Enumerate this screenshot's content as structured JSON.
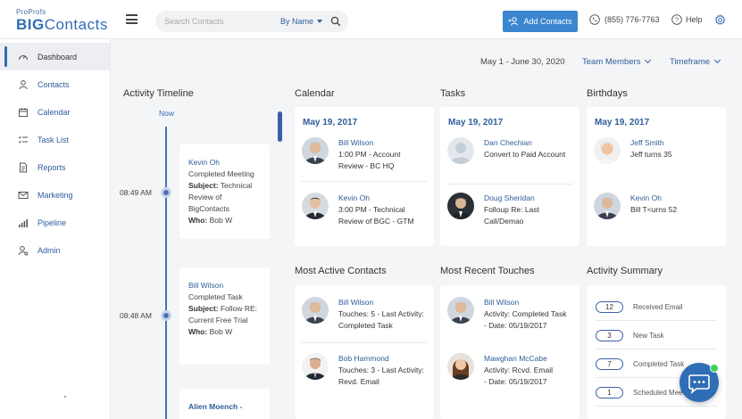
{
  "header": {
    "logo_small": "ProProfs",
    "logo_big": "BIG",
    "logo_rest": "Contacts",
    "search_placeholder": "Search Contacts",
    "search_by": "By Name",
    "add_contacts": "Add Contacts",
    "phone": "(855) 776-7763",
    "help": "Help"
  },
  "sidebar": {
    "items": [
      {
        "label": "Dashboard",
        "icon": "dashboard-icon"
      },
      {
        "label": "Contacts",
        "icon": "contacts-icon"
      },
      {
        "label": "Calendar",
        "icon": "calendar-icon"
      },
      {
        "label": "Task List",
        "icon": "task-list-icon"
      },
      {
        "label": "Reports",
        "icon": "reports-icon"
      },
      {
        "label": "Marketing",
        "icon": "marketing-icon"
      },
      {
        "label": "Pipeline",
        "icon": "pipeline-icon"
      },
      {
        "label": "Admin",
        "icon": "admin-icon"
      }
    ],
    "active": "Dashboard"
  },
  "filters": {
    "date_range": "May 1 - June 30, 2020",
    "team": "Team Members",
    "timeframe": "Timeframe"
  },
  "timeline": {
    "title": "Activity Timeline",
    "now": "Now",
    "items": [
      {
        "time": "08:49 AM",
        "name": "Kevin Oh",
        "line1": "Completed Meeting",
        "subject_label": "Subject:",
        "subject": "Technical Review of BigContacts",
        "who_label": "Who:",
        "who": "Bob W"
      },
      {
        "time": "08:48 AM",
        "name": "Bill Wilson",
        "line1": "Completed Task",
        "subject_label": "Subject:",
        "subject": "Follow RE: Current Free Trial",
        "who_label": "Who:",
        "who": "Bob W"
      },
      {
        "name": "Alien Moench -"
      }
    ]
  },
  "calendar": {
    "title": "Calendar",
    "date": "May 19, 2017",
    "entries": [
      {
        "name": "Bill Wilson",
        "detail": "1:00 PM - Account Review - BC HQ"
      },
      {
        "name": "Kevin Oh",
        "detail": "3:00 PM - Technical Review of BGC - GTM"
      }
    ]
  },
  "tasks": {
    "title": "Tasks",
    "date": "May 19, 2017",
    "entries": [
      {
        "name": "Dan Chechian",
        "detail": "Convert to Paid Account"
      },
      {
        "name": "Doug Sheridan",
        "detail": "Folloup Re: Last Call/Demao"
      }
    ]
  },
  "birthdays": {
    "title": "Birthdays",
    "date": "May 19, 2017",
    "entries": [
      {
        "name": "Jeff Smith",
        "detail": "Jeff turns 35"
      },
      {
        "name": "Kevin Oh",
        "detail": "Bill T<urns 52"
      }
    ]
  },
  "most_active": {
    "title": "Most Active Contacts",
    "entries": [
      {
        "name": "Bill Wilson",
        "detail_label": "Touches:",
        "detail": "5 - Last Activity:",
        "detail2": "Completed Task"
      },
      {
        "name": "Bob Hammond",
        "detail_label": "Touches:",
        "detail": "3 - Last Activity:",
        "detail2": "Revd. Email"
      }
    ]
  },
  "recent_touches": {
    "title": "Most Recent Touches",
    "entries": [
      {
        "name": "Bill Wilson",
        "activity_label": "Activity:",
        "activity": "Completed Task",
        "date_label": "- Date:",
        "date": "05/19/2017"
      },
      {
        "name": "Mawghan McCabe",
        "activity_label": "Activity:",
        "activity": "Rcvd. Email",
        "date_label": "- Date:",
        "date": "05/19/2017"
      }
    ]
  },
  "activity_summary": {
    "title": "Activity Summary",
    "rows": [
      {
        "count": "12",
        "label": "Received Email"
      },
      {
        "count": "3",
        "label": "New Task"
      },
      {
        "count": "7",
        "label": "Completed Task"
      },
      {
        "count": "1",
        "label": "Scheduled Mee"
      }
    ]
  },
  "colors": {
    "accent": "#2f6db5",
    "button": "#3b86cf",
    "chat_online": "#3ed05a"
  }
}
